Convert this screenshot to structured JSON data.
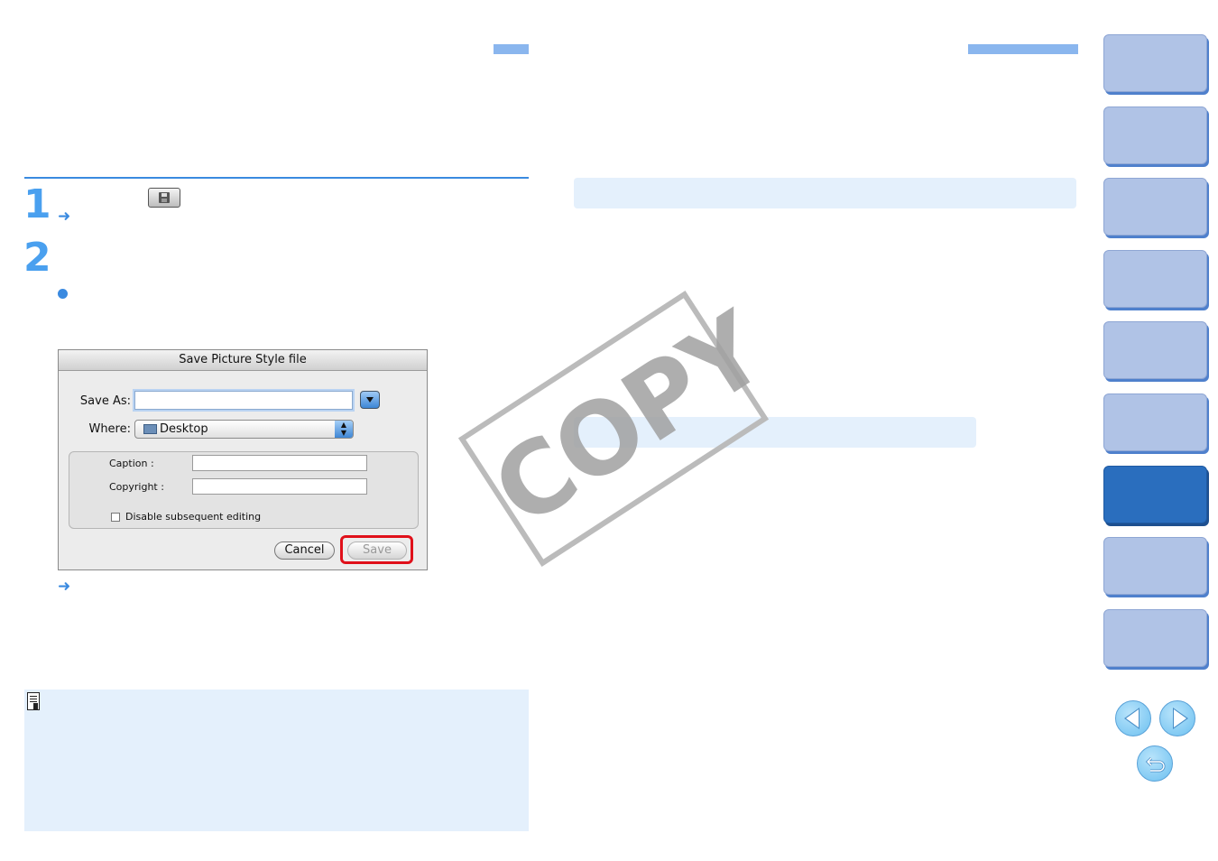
{
  "dialog": {
    "title": "Save Picture Style file",
    "save_as_label": "Save As:",
    "save_as_value": "",
    "where_label": "Where:",
    "where_value": "Desktop",
    "caption_label": "Caption :",
    "caption_value": "",
    "copyright_label": "Copyright :",
    "copyright_value": "",
    "disable_editing_label": "Disable subsequent editing",
    "disable_editing_checked": false,
    "cancel_label": "Cancel",
    "save_label": "Save"
  },
  "steps": [
    {
      "number": "1"
    },
    {
      "number": "2"
    }
  ],
  "watermark": "COPY",
  "side_tabs": {
    "count": 9,
    "active_index": 6
  },
  "nav": {
    "prev_icon": "prev-page-icon",
    "next_icon": "next-page-icon",
    "back_icon": "return-icon"
  },
  "colors": {
    "accent": "#3a8ae0",
    "tab": "#b0c3e6",
    "tab_active": "#2a6ebe",
    "panel": "#e4f0fc",
    "highlight": "#e0101a"
  }
}
